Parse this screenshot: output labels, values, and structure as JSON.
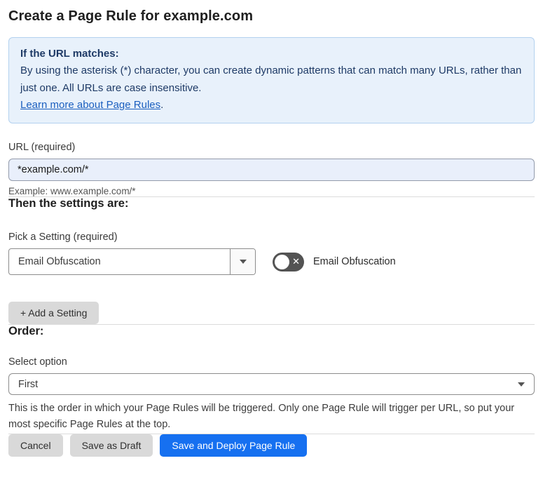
{
  "page": {
    "title": "Create a Page Rule for example.com"
  },
  "info_box": {
    "heading": "If the URL matches:",
    "body": "By using the asterisk (*) character, you can create dynamic patterns that can match many URLs, rather than just one. All URLs are case insensitive.",
    "link_label": "Learn more about Page Rules",
    "link_suffix": "."
  },
  "url_field": {
    "label": "URL (required)",
    "value": "*example.com/*",
    "example": "Example: www.example.com/*"
  },
  "settings_section": {
    "heading": "Then the settings are:",
    "picker_label": "Pick a Setting (required)",
    "picker_value": "Email Obfuscation",
    "toggle_label": "Email Obfuscation",
    "toggle_state": "off",
    "toggle_icon": "✕",
    "add_setting_label": "+ Add a Setting"
  },
  "order_section": {
    "heading": "Order:",
    "select_label": "Select option",
    "select_value": "First",
    "help_text": "This is the order in which your Page Rules will be triggered. Only one Page Rule will trigger per URL, so put your most specific Page Rules at the top."
  },
  "footer": {
    "cancel_label": "Cancel",
    "save_draft_label": "Save as Draft",
    "save_deploy_label": "Save and Deploy Page Rule"
  },
  "colors": {
    "primary_button": "#1670f0",
    "info_box_bg": "#e8f1fb",
    "info_box_border": "#b3d1ef",
    "info_text": "#1e3a66",
    "link": "#1b5fbf",
    "url_input_bg": "#e9effb",
    "toggle_off_bg": "#535353",
    "gray_button_bg": "#d9d9d9"
  }
}
